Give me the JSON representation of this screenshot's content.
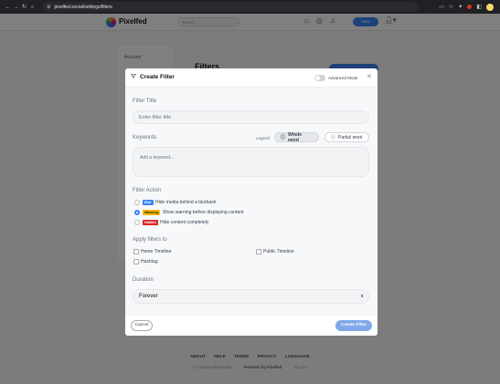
{
  "browser": {
    "url": "pixelfed.social/settings/filters",
    "nav_back": "←",
    "nav_forward": "→",
    "nav_reload": "↻",
    "nav_home": "⌂"
  },
  "site": {
    "brand": "Pixelfed",
    "search_placeholder": "Search",
    "new_button": "New",
    "sidebar_heading": "Account",
    "page_title": "Filters"
  },
  "modal": {
    "title": "Create Filter",
    "advanced_mode_label": "Advanced Mode",
    "filter_title_label": "Filter Title",
    "filter_title_placeholder": "Enter filter title",
    "keywords_label": "Keywords",
    "legend_label": "Legend",
    "whole_word_label": "Whole word",
    "partial_word_label": "Partial word",
    "keyword_placeholder": "Add a keyword...",
    "filter_action_label": "Filter Action",
    "actions": [
      {
        "badge": "Blur",
        "badge_color": "#3b82f6",
        "text": "Hide media behind a blurbash",
        "selected": false
      },
      {
        "badge": "Warning",
        "badge_color": "#f5b800",
        "text": "Show warning before displaying content",
        "selected": true
      },
      {
        "badge": "Hidden",
        "badge_color": "#dc2626",
        "text": "Hide content completely",
        "selected": false
      }
    ],
    "apply_to_label": "Apply filters to",
    "apply_options": {
      "home": "Home Timeline",
      "public": "Public Timeline",
      "hashtag": "Hashtag"
    },
    "duration_label": "Duration",
    "duration_value": "Forever",
    "cancel_label": "Cancel",
    "create_label": "Create Filter"
  },
  "footer": {
    "links": [
      "ABOUT",
      "HELP",
      "TERMS",
      "PRIVACY",
      "LANGUAGE"
    ],
    "copyright": "© 2025 pixelfed.social",
    "powered_by": "Powered by Pixelfed",
    "version": "v0.12.5"
  }
}
